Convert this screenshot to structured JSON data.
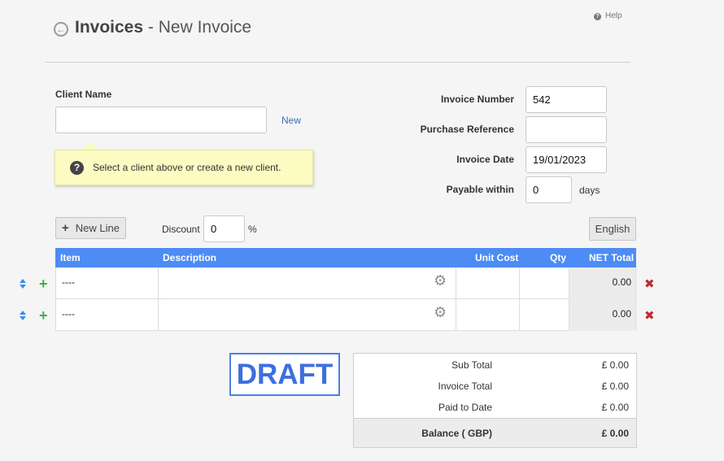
{
  "header": {
    "section": "Invoices",
    "separator": " - ",
    "page": "New Invoice",
    "help": "Help"
  },
  "client": {
    "label": "Client Name",
    "value": "",
    "new_link": "New",
    "tip": "Select a client above or create a new client."
  },
  "meta": {
    "invoice_number_label": "Invoice Number",
    "invoice_number": "542",
    "purchase_ref_label": "Purchase Reference",
    "purchase_ref": "",
    "invoice_date_label": "Invoice Date",
    "invoice_date": "19/01/2023",
    "payable_label": "Payable within",
    "payable": "0",
    "days": "days"
  },
  "toolbar": {
    "new_line": "New Line",
    "discount_label": "Discount",
    "discount": "0",
    "percent": "%",
    "language": "English"
  },
  "table": {
    "headers": [
      "Item",
      "Description",
      "Unit Cost",
      "Qty",
      "NET Total"
    ],
    "rows": [
      {
        "item": "----",
        "description": "",
        "unit_cost": "",
        "qty": "",
        "net_total": "0.00"
      },
      {
        "item": "----",
        "description": "",
        "unit_cost": "",
        "qty": "",
        "net_total": "0.00"
      }
    ]
  },
  "draft": "DRAFT",
  "totals": {
    "sub_total_label": "Sub Total",
    "sub_total": "£ 0.00",
    "invoice_total_label": "Invoice Total",
    "invoice_total": "£ 0.00",
    "paid_label": "Paid to Date",
    "paid": "£ 0.00",
    "balance_label": "Balance ( GBP)",
    "balance": "£ 0.00"
  },
  "icons": {
    "back": "circle-arrow-left-icon",
    "help": "question-circle-icon",
    "tip": "question-circle-icon",
    "new_line": "plus-icon",
    "description_settings": "gear-icon",
    "row_sort": "sort-icon",
    "row_add": "plus-icon",
    "row_delete": "close-icon"
  },
  "colors": {
    "table_header": "#4d8cf5",
    "draft": "#3d6ee0",
    "link": "#3a6fb5",
    "add": "#3cb043",
    "delete": "#c62828",
    "tip_bg": "#fbfbc2"
  }
}
